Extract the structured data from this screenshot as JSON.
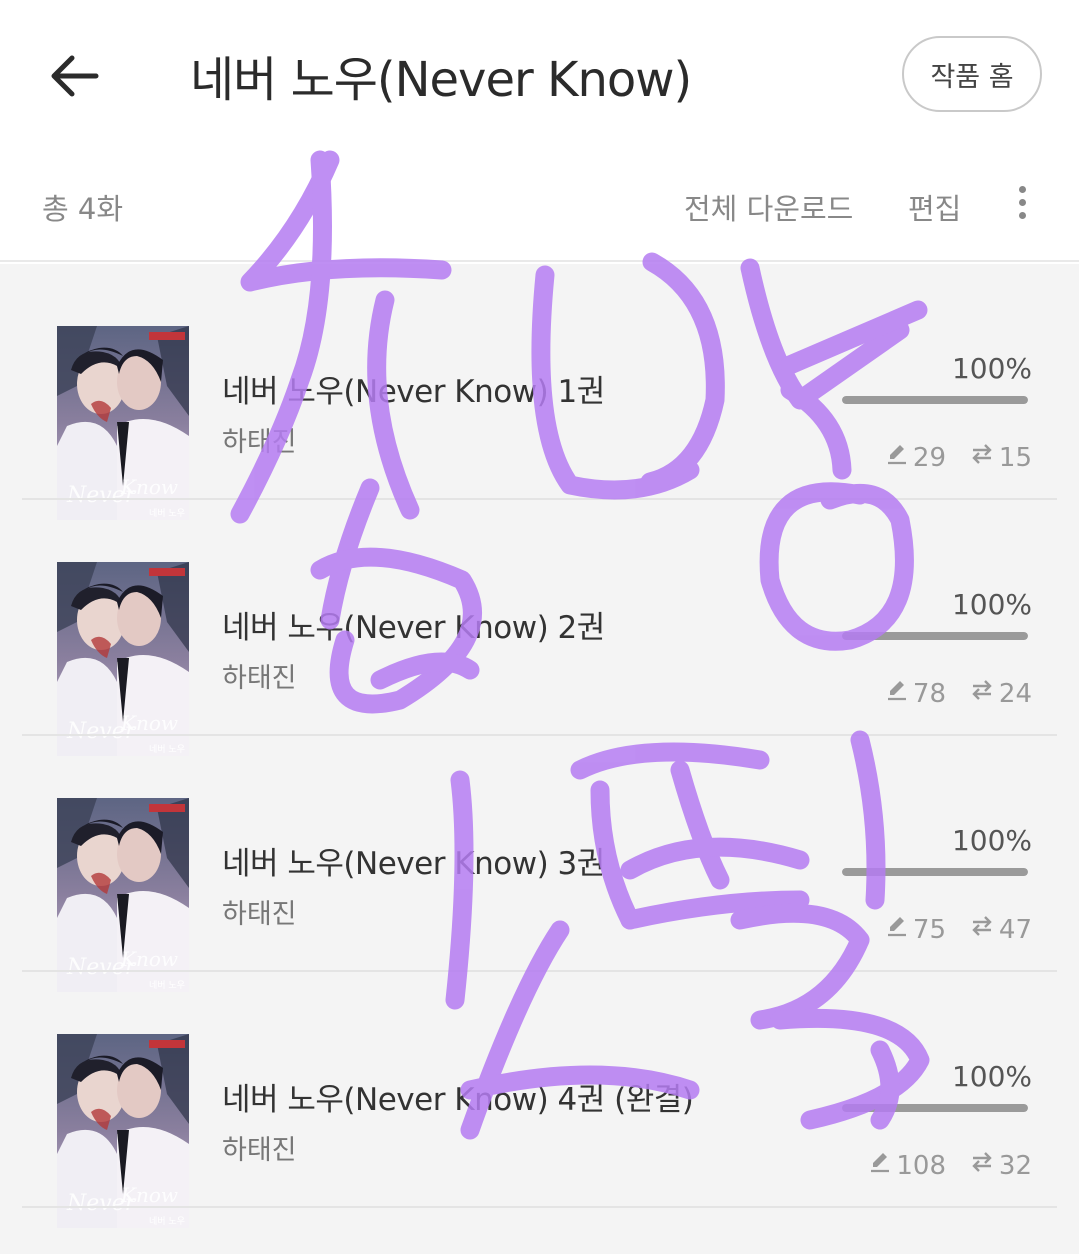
{
  "header": {
    "title": "네버 노우(Never Know)",
    "home_button": "작품 홈"
  },
  "toolbar": {
    "count": "총 4화",
    "download_all": "전체 다운로드",
    "edit": "편집"
  },
  "episodes": [
    {
      "title": "네버 노우(Never Know) 1권",
      "author": "하태진",
      "progress_label": "100%",
      "progress": 1.0,
      "notes": "29",
      "highlights": "15"
    },
    {
      "title": "네버 노우(Never Know) 2권",
      "author": "하태진",
      "progress_label": "100%",
      "progress": 1.0,
      "notes": "78",
      "highlights": "24"
    },
    {
      "title": "네버 노우(Never Know) 3권",
      "author": "하태진",
      "progress_label": "100%",
      "progress": 1.0,
      "notes": "75",
      "highlights": "47"
    },
    {
      "title": "네버 노우(Never Know) 4권 (완결)",
      "author": "하태진",
      "progress_label": "100%",
      "progress": 1.0,
      "notes": "108",
      "highlights": "32"
    }
  ],
  "colors": {
    "scribble": "#b57cf2",
    "progress_fill": "#9a9a9a",
    "list_background": "#f4f4f4"
  },
  "icons": {
    "back": "arrow-left-icon",
    "more": "more-vertical-icon",
    "note": "pencil-icon",
    "highlight": "swap-icon"
  }
}
